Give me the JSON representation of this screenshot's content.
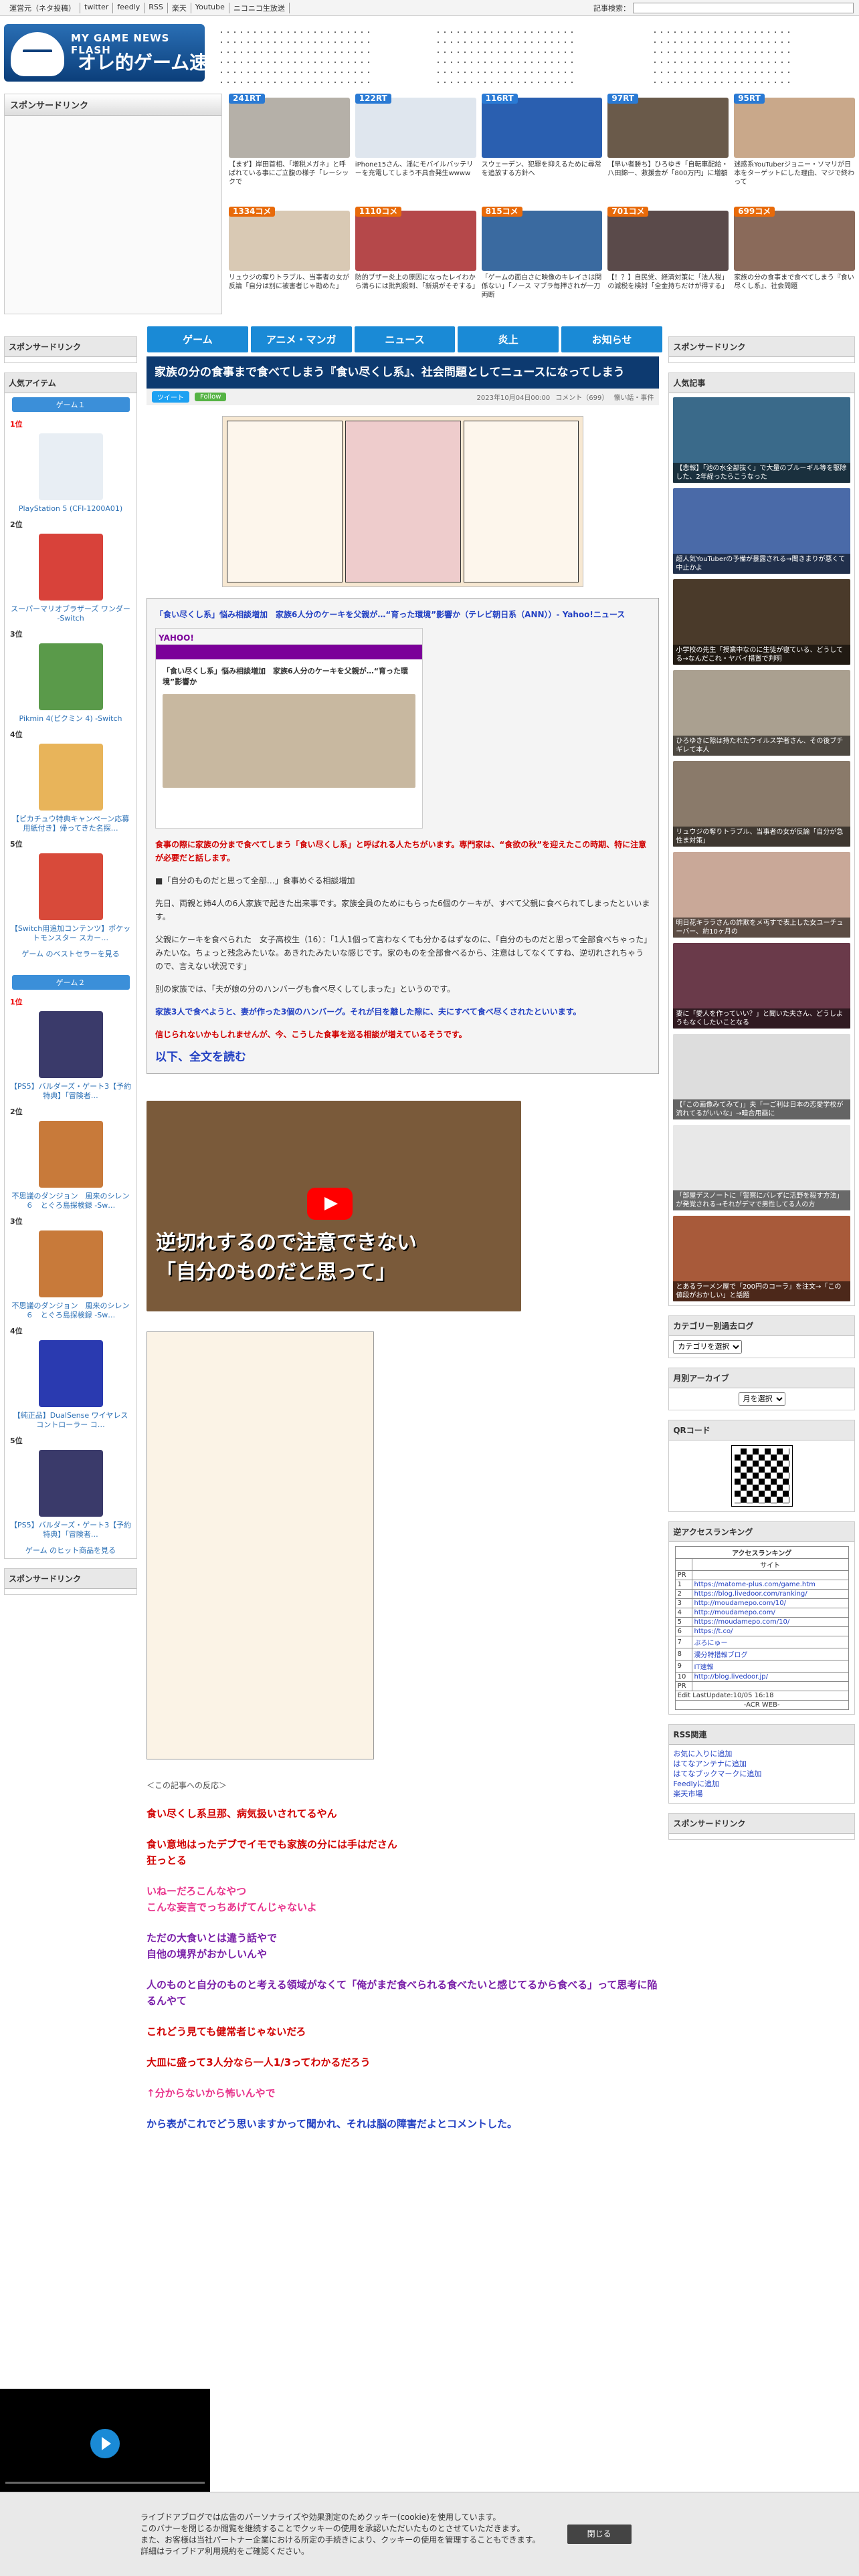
{
  "topbar": {
    "links": [
      "運営元（ネタ投稿）",
      "twitter",
      "feedly",
      "RSS",
      "楽天",
      "Youtube",
      "ニコニコ生放送"
    ],
    "search_label": "記事検索："
  },
  "logo": {
    "sub": "MY GAME NEWS FLASH",
    "main": "オレ的ゲーム速報@JIN"
  },
  "header_headlines": [
    [
      "・・・・・・・・・・・・・・・・・・・・・・・",
      "・・・・・・・・・・・・・・・・・・・・・・・",
      "・・・・・・・・・・・・・・・・・・・・・・・",
      "・・・・・・・・・・・・・・・・・・・・・・・",
      "・・・・・・・・・・・・・・・・・・・・・・・",
      "・・・・・・・・・・・・・・・・・・・・・・・"
    ],
    [
      "・・・・・・・・・・・・・・・・・・・・・",
      "・・・・・・・・・・・・・・・・・・・・・",
      "・・・・・・・・・・・・・・・・・・・・・",
      "・・・・・・・・・・・・・・・・・・・・・",
      "・・・・・・・・・・・・・・・・・・・・・",
      "・・・・・・・・・・・・・・・・・・・・・"
    ],
    [
      "・・・・・・・・・・・・・・・・・・・・・",
      "・・・・・・・・・・・・・・・・・・・・・",
      "・・・・・・・・・・・・・・・・・・・・・",
      "・・・・・・・・・・・・・・・・・・・・・",
      "・・・・・・・・・・・・・・・・・・・・・",
      "・・・・・・・・・・・・・・・・・・・・・"
    ]
  ],
  "sponsored_label": "スポンサードリンク",
  "top_articles": [
    {
      "badge": "241RT",
      "color": "#2a7ad4",
      "img": "#b5b0a8",
      "cap": "【まず】岸田首相、「増税メガネ」と呼ばれている事にご立腹の様子「レーシックで"
    },
    {
      "badge": "122RT",
      "color": "#2a7ad4",
      "img": "#dfe6ee",
      "cap": "iPhone15さん、淫にモバイルバッテリーを充電してしまう不具合発生wwww"
    },
    {
      "badge": "116RT",
      "color": "#2a7ad4",
      "img": "#2a5fb0",
      "cap": "スウェーデン、犯罪を抑えるために尋常を追放する方針へ"
    },
    {
      "badge": "97RT",
      "color": "#2a7ad4",
      "img": "#6a5a4a",
      "cap": "【早い者勝ち】ひろゆき「自転車配給・八田錦一、救援金が「800万円」に増額"
    },
    {
      "badge": "95RT",
      "color": "#2a7ad4",
      "img": "#c9a88a",
      "cap": "迷惑系YouTuberジョニー・ソマリが日本をターゲットにした理由、マジで終わって"
    },
    {
      "badge": "1334コメ",
      "color": "#e86a0a",
      "img": "#d9c9b4",
      "cap": "リュウジの奪りトラブル、当事者の女が反論「自分は別に被害者じゃ勘めた」"
    },
    {
      "badge": "1110コメ",
      "color": "#e86a0a",
      "img": "#b5484a",
      "cap": "防的ブザー炎上の原因になったレイわから満らには批判殺到、「新規がそぞする」"
    },
    {
      "badge": "815コメ",
      "color": "#e86a0a",
      "img": "#3a6aa0",
      "cap": "「ゲームの面白さに映像のキレイさは関係ない」「ノース マブラ毎押されが一刀両断"
    },
    {
      "badge": "701コメ",
      "color": "#e86a0a",
      "img": "#5a4a4a",
      "cap": "【！？】自民党、経済対策に「法人税」の減税を検討「全金持ちだけが得する」"
    },
    {
      "badge": "699コメ",
      "color": "#e86a0a",
      "img": "#8a6a5a",
      "cap": "家族の分の食事まで食べてしまう『食い尽くし系』、社会問題"
    }
  ],
  "nav": [
    "ゲーム",
    "アニメ・マンガ",
    "ニュース",
    "炎上",
    "お知らせ"
  ],
  "left": {
    "popular_title": "人気アイテム",
    "game1_tab": "ゲーム１",
    "game1": [
      {
        "rank": "1位",
        "name": "PlayStation 5 (CFI-1200A01)",
        "color": "#e8eef4"
      },
      {
        "rank": "2位",
        "name": "スーパーマリオブラザーズ ワンダー -Switch",
        "color": "#d8423a"
      },
      {
        "rank": "3位",
        "name": "Pikmin 4(ピクミン 4) -Switch",
        "color": "#5a9a4a"
      },
      {
        "rank": "4位",
        "name": "【ピカチュウ特典キャンペーン応募用紙付き】帰ってきた名探…",
        "color": "#e8b45a"
      },
      {
        "rank": "5位",
        "name": "【Switch用追加コンテンツ】ポケットモンスター スカー…",
        "color": "#d84a3a"
      }
    ],
    "more1": "ゲーム のベストセラーを見る",
    "game2_tab": "ゲーム２",
    "game2": [
      {
        "rank": "1位",
        "name": "【PS5】バルダーズ・ゲート3【予約特典】「冒険者…",
        "color": "#3a3a6a"
      },
      {
        "rank": "2位",
        "name": "不思議のダンジョン　風来のシレン６　とぐろ島探検録 -Sw…",
        "color": "#c87a3a"
      },
      {
        "rank": "3位",
        "name": "不思議のダンジョン　風来のシレン６　とぐろ島探検録 -Sw…",
        "color": "#c87a3a"
      },
      {
        "rank": "4位",
        "name": "【純正品】DualSense ワイヤレスコントローラー コ…",
        "color": "#2a3ab0"
      },
      {
        "rank": "5位",
        "name": "【PS5】バルダーズ・ゲート3【予約特典】「冒険者…",
        "color": "#3a3a6a"
      }
    ],
    "more2": "ゲーム のヒット商品を見る",
    "sponsored": "スポンサードリンク"
  },
  "article": {
    "title": "家族の分の食事まで食べてしまう『食い尽くし系』、社会問題としてニュースになってしまう",
    "tweet": "ツイート",
    "follow": "Follow",
    "date": "2023年10月04日00:00",
    "comments": "コメント（699）",
    "category": "懐い話・事件",
    "quote_title": "「食い尽くし系」悩み相談増加　家族6人分のケーキを父親が…“育った環境”影響か（テレビ朝日系（ANN））- Yahoo!ニュース",
    "yahoo_caption": "「食い尽くし系」悩み相談増加　家族6人分のケーキを父親が…“育った環境”影響か",
    "p1": "食事の際に家族の分まで食べてしまう「食い尽くし系」と呼ばれる人たちがいます。専門家は、“食欲の秋”を迎えたこの時期、特に注意が必要だと話します。",
    "p2": "■「自分のものだと思って全部…」食事めぐる相談増加",
    "p3": "先日、両親と姉4人の6人家族で起きた出来事です。家族全員のためにもらった6個のケーキが、すべて父親に食べられてしまったといいます。",
    "p4": "父親にケーキを食べられた　女子高校生（16）：「1人1個って言わなくても分かるはずなのに、「自分のものだと思って全部食べちゃった」みたいな。ちょっと残念みたいな。あきれたみたいな感じです。家のものを全部食べるから、注意はしてなくてすね、逆切れされちゃうので、言えない状況です」",
    "p5": "別の家族では、「夫が娘の分のハンバーグも食べ尽くしてしまった」というのです。",
    "p6": "家族3人で食べようと、妻が作った3個のハンバーグ。それが目を離した隙に、夫にすべて食べ尽くされたといいます。",
    "p7": "信じられないかもしれませんが、今、こうした食事を巡る相談が増えているそうです。",
    "readmore": "以下、全文を読む",
    "video_title": "逆切れするので注意できない",
    "video_sub": "「自分のものだと思って」",
    "reaction_header": "＜この記事への反応＞",
    "reactions": [
      {
        "text": "食い尽くし系旦那、病気扱いされてるやん",
        "cls": "red"
      },
      {
        "text": "食い意地はったデブでイモでも家族の分には手はださん\n狂っとる",
        "cls": "red"
      },
      {
        "text": "いねーだろこんなやつ\nこんな妄言でっちあげてんじゃないよ",
        "cls": "pink"
      },
      {
        "text": "ただの大食いとは違う話やで\n自他の境界がおかしいんや",
        "cls": "purple"
      },
      {
        "text": "人のものと自分のものと考える領域がなくて「俺がまだ食べられる食べたいと感じてるから食べる」って思考に陥るんやて",
        "cls": "purple"
      },
      {
        "text": "これどう見ても健常者じゃないだろ",
        "cls": "red"
      },
      {
        "text": "大皿に盛って3人分なら一人1/3ってわかるだろう",
        "cls": "red"
      },
      {
        "text": "↑分からないから怖いんやで",
        "cls": "pink"
      },
      {
        "text": "から表がこれでどう思いますかって聞かれ、それは脳の障害だよとコメントした。",
        "cls": "blue2"
      }
    ]
  },
  "right": {
    "sponsored": "スポンサードリンク",
    "popular": "人気記事",
    "side_articles": [
      {
        "text": "【悲報】「池の水全部抜く」で大量のブルーギル等を駆除した、2年経ったらこうなった",
        "color": "#3a6a8a"
      },
      {
        "text": "超人気YouTuberの予備が暴露される→聞きまりが悪くて中止かよ",
        "color": "#4a6aa8"
      },
      {
        "text": "小学校の先生「授業中なのに生徒が寝ている、どうしてる→なんだこれ・ヤバイ措置で判明",
        "color": "#4a3a2a"
      },
      {
        "text": "ひろゆきに隙は持たれたウイルス学者さん、その後ブチギレて本人",
        "color": "#aaa090"
      },
      {
        "text": "リュウジの奪りトラブル、当事者の女が反論「自分が急性ま対策」",
        "color": "#8a7a6a"
      },
      {
        "text": "明日花キララさんの詐欺をメ丐すで表上した女ユーチューバー、約10ヶ月の",
        "color": "#c9a898"
      },
      {
        "text": "妻に「愛人を作っていい？」と聞いた夫さん、どうしようもなくしたいことなる",
        "color": "#6a3a4a"
      },
      {
        "text": "【「この画像みてみて」」夫「一ご利は日本の恋愛学校が流れてるがいいな」→暗合用画に",
        "color": "#ddd"
      },
      {
        "text": "「部屋デスノートに「警察にバレずに活野を殺す方法」が発覚される→それがデマで男性してる人の方",
        "color": "#e8e8e8"
      },
      {
        "text": "とあるラーメン屋で「200円のコーラ」を注文→「この値段がおかしい」と話題",
        "color": "#a85a3a"
      }
    ],
    "category_title": "カテゴリー別過去ログ",
    "category_select": "カテゴリを選択",
    "archive_title": "月別アーカイブ",
    "archive_select": "月を選択",
    "qr_title": "QRコード",
    "acr_title": "逆アクセスランキング",
    "acr_head": "アクセスランキング",
    "acr_site": "サイト",
    "acr_rows": [
      [
        "PR",
        ""
      ],
      [
        "1",
        "https://matome-plus.com/game.htm"
      ],
      [
        "2",
        "https://blog.livedoor.com/ranking/"
      ],
      [
        "3",
        "http://moudamepo.com/10/"
      ],
      [
        "4",
        "http://moudamepo.com/"
      ],
      [
        "5",
        "https://moudamepo.com/10/"
      ],
      [
        "6",
        "https://t.co/"
      ],
      [
        "7",
        "ぶろにゅー"
      ],
      [
        "8",
        "漫分特措報ブログ"
      ],
      [
        "9",
        "IT速報"
      ],
      [
        "10",
        "http://blog.livedoor.jp/"
      ],
      [
        "PR",
        ""
      ]
    ],
    "acr_footer": "Edit LastUpdate:10/05 16:18",
    "acr_brand": "-ACR WEB-",
    "rss_title": "RSS関連",
    "rss_links": [
      "お気に入りに追加",
      "はてなアンテナに追加",
      "はてなブックマークに追加",
      "Feedlyに追加",
      "楽天市場"
    ],
    "sponsored2": "スポンサードリンク"
  },
  "cookie": {
    "line1": "ライブドアブログでは広告のパーソナライズや効果測定のためクッキー(cookie)を使用しています。",
    "line2": "このバナーを閉じるか閲覧を継続することでクッキーの使用を承認いただいたものとさせていただきます。",
    "line3": "また、お客様は当社パートナー企業における所定の手続きにより、クッキーの使用を管理することもできます。",
    "line4": "詳細はライブドア利用規約をご確認ください。",
    "close": "閉じる"
  }
}
